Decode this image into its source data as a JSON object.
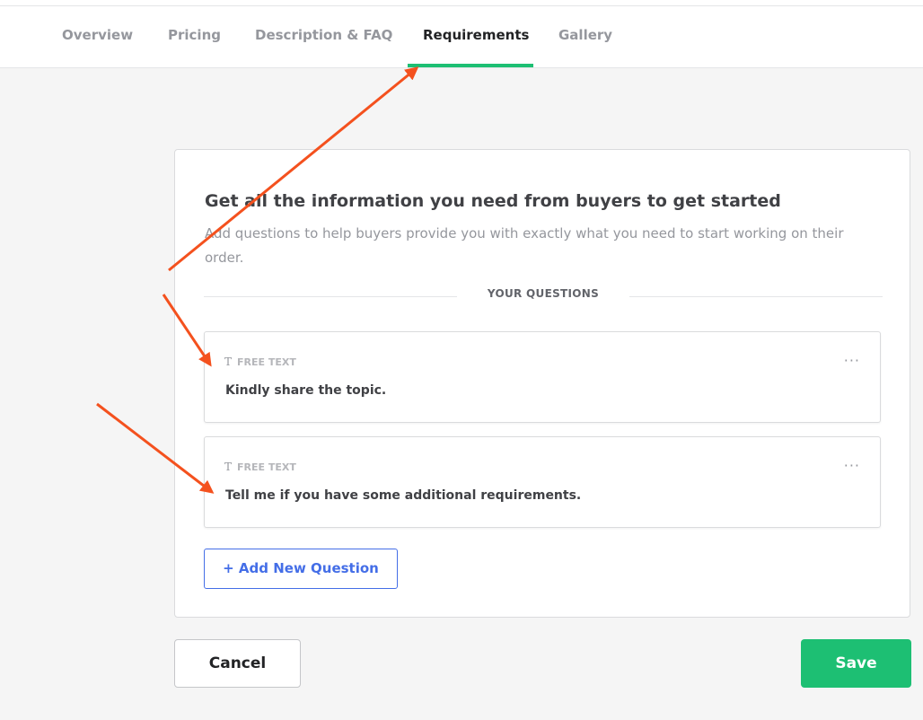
{
  "tabs": [
    {
      "label": "Overview"
    },
    {
      "label": "Pricing"
    },
    {
      "label": "Description & FAQ"
    },
    {
      "label": "Requirements",
      "active": true
    },
    {
      "label": "Gallery"
    }
  ],
  "card": {
    "title": "Get all the information you need from buyers to get started",
    "subtitle": "Add questions to help buyers provide you with exactly what you need to start working on their order.",
    "section_label": "YOUR QUESTIONS",
    "questions": [
      {
        "type_icon": "T",
        "type": "FREE TEXT",
        "text": "Kindly share the topic.",
        "more": "···"
      },
      {
        "type_icon": "T",
        "type": "FREE TEXT",
        "text": "Tell me if you have some additional requirements.",
        "more": "···"
      }
    ],
    "add_button": "+ Add New Question"
  },
  "actions": {
    "cancel": "Cancel",
    "save": "Save"
  },
  "colors": {
    "accent": "#1dbf73",
    "link": "#446ee7",
    "annotation_arrow": "#f4511e"
  }
}
